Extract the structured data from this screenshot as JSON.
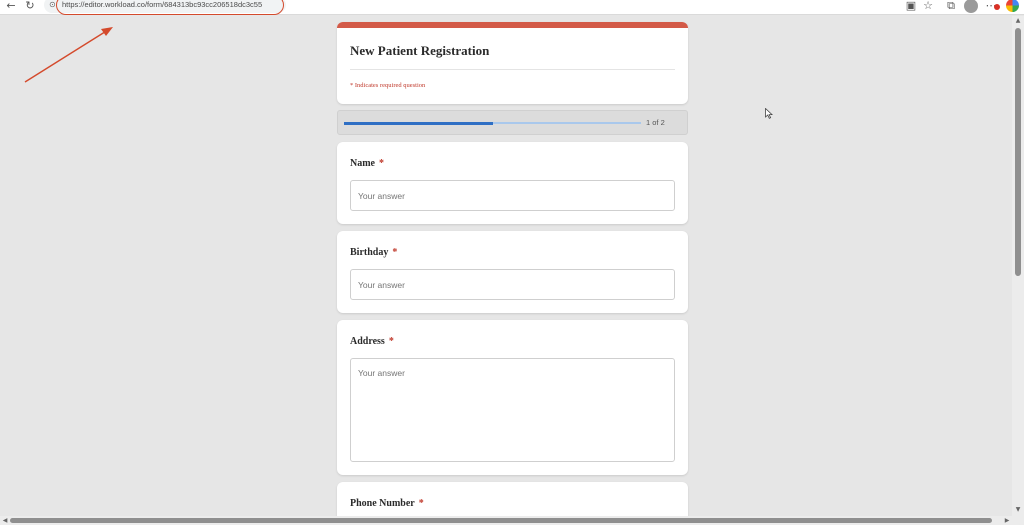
{
  "browser": {
    "url": "https://editor.workload.co/form/684313bc93cc206518dc3c55",
    "icons": [
      "back-icon",
      "reload-icon",
      "site-info-icon",
      "reading-view-icon",
      "favorite-star-icon",
      "extensions-icon",
      "profile-avatar",
      "more-options-icon",
      "copilot-icon"
    ]
  },
  "form": {
    "title": "New Patient Registration",
    "required_note": "* Indicates required question",
    "header_accent_color": "#d35a48",
    "progress": {
      "label": "1 of 2",
      "fraction": 0.5
    },
    "questions": [
      {
        "label": "Name",
        "required_mark": "*",
        "placeholder": "Your answer"
      },
      {
        "label": "Birthday",
        "required_mark": "*",
        "placeholder": "Your answer"
      },
      {
        "label": "Address",
        "required_mark": "*",
        "placeholder": "Your answer"
      },
      {
        "label": "Phone Number",
        "required_mark": "*"
      }
    ]
  },
  "annotation": {
    "color": "#d44a2c"
  }
}
